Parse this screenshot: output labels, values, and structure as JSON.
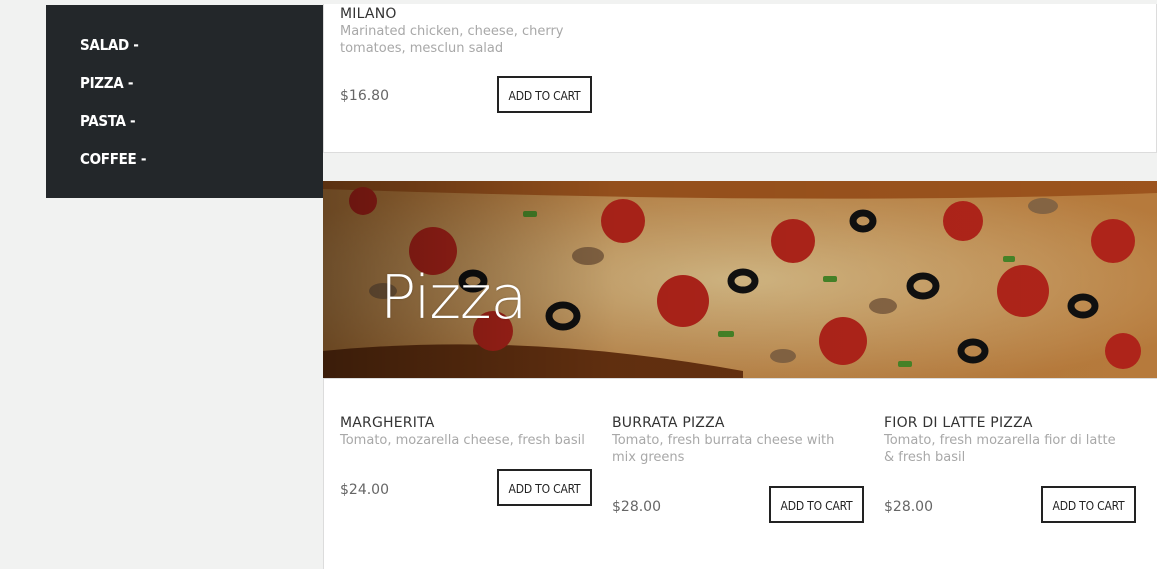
{
  "sidebar": {
    "items": [
      {
        "label": "SALAD -"
      },
      {
        "label": "PIZZA -"
      },
      {
        "label": "PASTA -"
      },
      {
        "label": "COFFEE -"
      }
    ]
  },
  "salad_section": {
    "items": [
      {
        "name": "MILANO",
        "description": "Marinated chicken, cheese, cherry tomatoes, mesclun salad",
        "price": "$16.80",
        "button": "ADD TO CART"
      }
    ]
  },
  "pizza_section": {
    "title": "Pizza",
    "items": [
      {
        "name": "MARGHERITA",
        "description": "Tomato, mozarella cheese, fresh basil",
        "price": "$24.00",
        "button": "ADD TO CART"
      },
      {
        "name": "BURRATA PIZZA",
        "description": "Tomato, fresh burrata cheese with mix greens",
        "price": "$28.00",
        "button": "ADD TO CART"
      },
      {
        "name": "FIOR DI LATTE PIZZA",
        "description": "Tomato, fresh mozarella fior di latte & fresh basil",
        "price": "$28.00",
        "button": "ADD TO CART"
      }
    ]
  }
}
